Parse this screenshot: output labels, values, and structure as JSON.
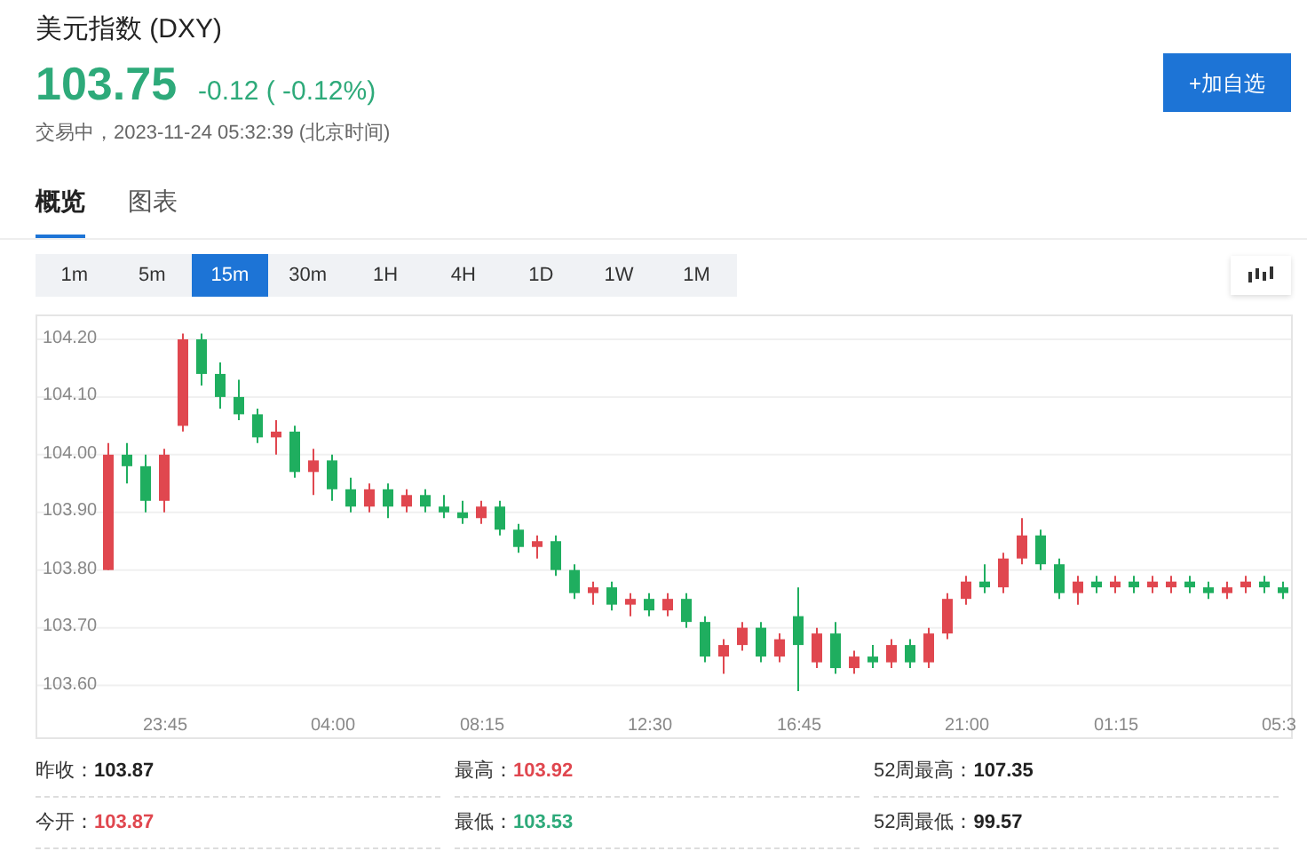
{
  "header": {
    "title": "美元指数 (DXY)",
    "price": "103.75",
    "change": "-0.12 ( -0.12%)",
    "color": "#2eaa7a",
    "status": "交易中，2023-11-24 05:32:39 (北京时间)",
    "add_button": "+加自选"
  },
  "tabs": [
    {
      "label": "概览",
      "selected": true
    },
    {
      "label": "图表",
      "selected": false
    }
  ],
  "intervals": [
    {
      "label": "1m",
      "selected": false
    },
    {
      "label": "5m",
      "selected": false
    },
    {
      "label": "15m",
      "selected": true
    },
    {
      "label": "30m",
      "selected": false
    },
    {
      "label": "1H",
      "selected": false
    },
    {
      "label": "4H",
      "selected": false
    },
    {
      "label": "1D",
      "selected": false
    },
    {
      "label": "1W",
      "selected": false
    },
    {
      "label": "1M",
      "selected": false
    }
  ],
  "chart": {
    "chart_data": {
      "type": "candlestick",
      "categories": [
        null,
        null,
        null,
        "23:45",
        null,
        null,
        null,
        null,
        null,
        null,
        null,
        null,
        "04:00",
        null,
        null,
        null,
        null,
        null,
        null,
        null,
        "08:15",
        null,
        null,
        null,
        null,
        null,
        null,
        null,
        null,
        "12:30",
        null,
        null,
        null,
        null,
        null,
        null,
        null,
        "16:45",
        null,
        null,
        null,
        null,
        null,
        null,
        null,
        null,
        "21:00",
        null,
        null,
        null,
        null,
        null,
        null,
        null,
        "01:15",
        null,
        null,
        null,
        null,
        null,
        null,
        null,
        null,
        "05:3"
      ],
      "ylim": [
        103.51,
        104.24
      ],
      "grid": true,
      "ohlc": [
        [
          103.8,
          104.02,
          103.8,
          104.0
        ],
        [
          104.0,
          104.02,
          103.95,
          103.98
        ],
        [
          103.98,
          104.0,
          103.9,
          103.92
        ],
        [
          103.92,
          104.01,
          103.9,
          104.0
        ],
        [
          104.05,
          104.21,
          104.04,
          104.2
        ],
        [
          104.2,
          104.21,
          104.12,
          104.14
        ],
        [
          104.14,
          104.16,
          104.08,
          104.1
        ],
        [
          104.1,
          104.13,
          104.06,
          104.07
        ],
        [
          104.07,
          104.08,
          104.02,
          104.03
        ],
        [
          104.03,
          104.06,
          104.0,
          104.04
        ],
        [
          104.04,
          104.05,
          103.96,
          103.97
        ],
        [
          103.97,
          104.01,
          103.93,
          103.99
        ],
        [
          103.99,
          104.0,
          103.92,
          103.94
        ],
        [
          103.94,
          103.96,
          103.9,
          103.91
        ],
        [
          103.91,
          103.95,
          103.9,
          103.94
        ],
        [
          103.94,
          103.95,
          103.89,
          103.91
        ],
        [
          103.91,
          103.94,
          103.9,
          103.93
        ],
        [
          103.93,
          103.94,
          103.9,
          103.91
        ],
        [
          103.91,
          103.93,
          103.89,
          103.9
        ],
        [
          103.9,
          103.92,
          103.88,
          103.89
        ],
        [
          103.89,
          103.92,
          103.88,
          103.91
        ],
        [
          103.91,
          103.92,
          103.86,
          103.87
        ],
        [
          103.87,
          103.88,
          103.83,
          103.84
        ],
        [
          103.84,
          103.86,
          103.82,
          103.85
        ],
        [
          103.85,
          103.86,
          103.79,
          103.8
        ],
        [
          103.8,
          103.81,
          103.75,
          103.76
        ],
        [
          103.76,
          103.78,
          103.74,
          103.77
        ],
        [
          103.77,
          103.78,
          103.73,
          103.74
        ],
        [
          103.74,
          103.76,
          103.72,
          103.75
        ],
        [
          103.75,
          103.76,
          103.72,
          103.73
        ],
        [
          103.73,
          103.76,
          103.72,
          103.75
        ],
        [
          103.75,
          103.76,
          103.7,
          103.71
        ],
        [
          103.71,
          103.72,
          103.64,
          103.65
        ],
        [
          103.65,
          103.68,
          103.62,
          103.67
        ],
        [
          103.67,
          103.71,
          103.66,
          103.7
        ],
        [
          103.7,
          103.71,
          103.64,
          103.65
        ],
        [
          103.65,
          103.69,
          103.64,
          103.68
        ],
        [
          103.72,
          103.77,
          103.59,
          103.67
        ],
        [
          103.64,
          103.7,
          103.63,
          103.69
        ],
        [
          103.69,
          103.71,
          103.62,
          103.63
        ],
        [
          103.63,
          103.66,
          103.62,
          103.65
        ],
        [
          103.65,
          103.67,
          103.63,
          103.64
        ],
        [
          103.64,
          103.68,
          103.63,
          103.67
        ],
        [
          103.67,
          103.68,
          103.63,
          103.64
        ],
        [
          103.64,
          103.7,
          103.63,
          103.69
        ],
        [
          103.69,
          103.76,
          103.68,
          103.75
        ],
        [
          103.75,
          103.79,
          103.74,
          103.78
        ],
        [
          103.78,
          103.81,
          103.76,
          103.77
        ],
        [
          103.77,
          103.83,
          103.76,
          103.82
        ],
        [
          103.82,
          103.89,
          103.81,
          103.86
        ],
        [
          103.86,
          103.87,
          103.8,
          103.81
        ],
        [
          103.81,
          103.82,
          103.75,
          103.76
        ],
        [
          103.76,
          103.79,
          103.74,
          103.78
        ],
        [
          103.78,
          103.79,
          103.76,
          103.77
        ],
        [
          103.77,
          103.79,
          103.76,
          103.78
        ],
        [
          103.78,
          103.79,
          103.76,
          103.77
        ],
        [
          103.77,
          103.79,
          103.76,
          103.78
        ],
        [
          103.77,
          103.79,
          103.76,
          103.78
        ],
        [
          103.78,
          103.79,
          103.76,
          103.77
        ],
        [
          103.77,
          103.78,
          103.75,
          103.76
        ],
        [
          103.76,
          103.78,
          103.75,
          103.77
        ],
        [
          103.77,
          103.79,
          103.76,
          103.78
        ],
        [
          103.78,
          103.79,
          103.76,
          103.77
        ],
        [
          103.77,
          103.78,
          103.75,
          103.76
        ]
      ],
      "yticks": [
        {
          "value": 104.2,
          "label": "104.20"
        },
        {
          "value": 104.1,
          "label": "104.10"
        },
        {
          "value": 104.0,
          "label": "104.00"
        },
        {
          "value": 103.9,
          "label": "103.90"
        },
        {
          "value": 103.8,
          "label": "103.80"
        },
        {
          "value": 103.7,
          "label": "103.70"
        },
        {
          "value": 103.6,
          "label": "103.60"
        }
      ],
      "xlabel": null
    }
  },
  "stats": [
    {
      "label": "昨收：",
      "value": "103.87",
      "color": "#222222"
    },
    {
      "label": "最高：",
      "value": "103.92",
      "color": "#e0474f"
    },
    {
      "label": "52周最高：",
      "value": "107.35",
      "color": "#222222"
    },
    {
      "label": "今开：",
      "value": "103.87",
      "color": "#e0474f"
    },
    {
      "label": "最低：",
      "value": "103.53",
      "color": "#2eaa7a"
    },
    {
      "label": "52周最低：",
      "value": "99.57",
      "color": "#222222"
    }
  ]
}
